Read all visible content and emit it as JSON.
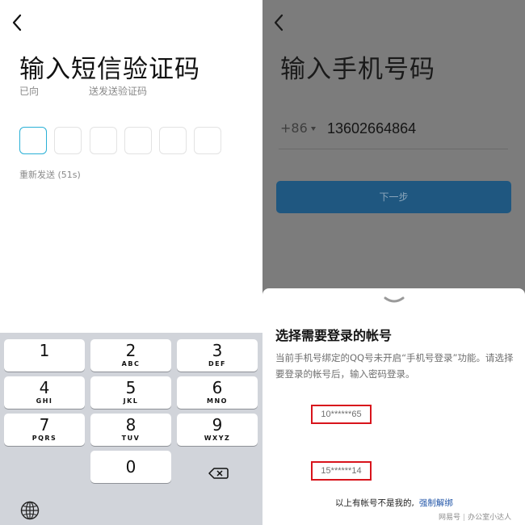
{
  "left": {
    "title": "输入短信验证码",
    "sent_prefix": "已向",
    "sent_suffix": "送发送验证码",
    "code_box_count": 6,
    "resend_label": "重新发送 (51s)",
    "keys": [
      {
        "num": "1",
        "letters": ""
      },
      {
        "num": "2",
        "letters": "ABC"
      },
      {
        "num": "3",
        "letters": "DEF"
      },
      {
        "num": "4",
        "letters": "GHI"
      },
      {
        "num": "5",
        "letters": "JKL"
      },
      {
        "num": "6",
        "letters": "MNO"
      },
      {
        "num": "7",
        "letters": "PQRS"
      },
      {
        "num": "8",
        "letters": "TUV"
      },
      {
        "num": "9",
        "letters": "WXYZ"
      },
      {
        "num": "0",
        "letters": ""
      }
    ]
  },
  "right": {
    "title": "输入手机号码",
    "country_code": "+86",
    "phone_value": "13602664864",
    "next_label": "下一步",
    "sheet": {
      "title": "选择需要登录的帐号",
      "description": "当前手机号绑定的QQ号未开启“手机号登录”功能。请选择要登录的帐号后，输入密码登录。",
      "accounts": [
        "10******65",
        "15******14"
      ],
      "footer_text": "以上有帐号不是我的,",
      "footer_link": "强制解绑"
    },
    "watermark": {
      "source": "网易号",
      "author": "办公室小达人"
    }
  },
  "colors": {
    "accent_cyan": "#2ab0d6",
    "button_blue": "#1f5780",
    "highlight_red": "#d8141c",
    "link_blue": "#2256a8",
    "overlay_gray": "#7c7c7c"
  }
}
